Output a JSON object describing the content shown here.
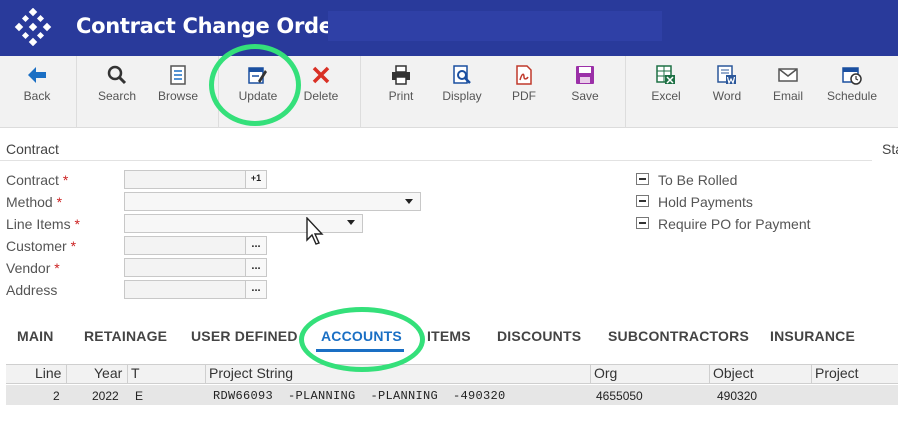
{
  "window": {
    "title": "Contract Change Orders"
  },
  "toolbar": {
    "buttons": [
      {
        "label": "Back",
        "icon": "back-arrow-icon"
      },
      {
        "label": "Search",
        "icon": "search-icon"
      },
      {
        "label": "Browse",
        "icon": "browse-icon"
      },
      {
        "label": "Update",
        "icon": "edit-icon"
      },
      {
        "label": "Delete",
        "icon": "delete-icon"
      },
      {
        "label": "Print",
        "icon": "printer-icon"
      },
      {
        "label": "Display",
        "icon": "display-icon"
      },
      {
        "label": "PDF",
        "icon": "pdf-icon"
      },
      {
        "label": "Save",
        "icon": "save-icon"
      },
      {
        "label": "Excel",
        "icon": "excel-icon"
      },
      {
        "label": "Word",
        "icon": "word-icon"
      },
      {
        "label": "Email",
        "icon": "email-icon"
      },
      {
        "label": "Schedule",
        "icon": "schedule-icon"
      }
    ]
  },
  "form": {
    "section_title": "Contract",
    "side_section_title": "Sta",
    "fields": [
      {
        "label": "Contract",
        "required": true,
        "value": "",
        "button": "+1"
      },
      {
        "label": "Method",
        "required": true,
        "value": "",
        "type": "dropdown"
      },
      {
        "label": "Line Items",
        "required": true,
        "value": "",
        "type": "dropdown"
      },
      {
        "label": "Customer",
        "required": true,
        "value": "",
        "button": "..."
      },
      {
        "label": "Vendor",
        "required": true,
        "value": "",
        "button": "..."
      },
      {
        "label": "Address",
        "required": false,
        "value": "",
        "button": "..."
      }
    ],
    "required_marker": "*",
    "checkboxes": [
      {
        "label": "To Be Rolled"
      },
      {
        "label": "Hold Payments"
      },
      {
        "label": "Require PO for Payment"
      }
    ]
  },
  "tabs": [
    {
      "label": "MAIN"
    },
    {
      "label": "RETAINAGE"
    },
    {
      "label": "USER DEFINED"
    },
    {
      "label": "ACCOUNTS",
      "active": true
    },
    {
      "label": "ITEMS"
    },
    {
      "label": "DISCOUNTS"
    },
    {
      "label": "SUBCONTRACTORS"
    },
    {
      "label": "INSURANCE"
    }
  ],
  "table": {
    "columns": [
      "Line",
      "Year",
      "T",
      "Project String",
      "Org",
      "Object",
      "Project"
    ],
    "rows": [
      {
        "line": "2",
        "year": "2022",
        "t": "E",
        "project_string": "RDW66093  -PLANNING  -PLANNING  -490320",
        "org": "4655050",
        "object": "490320",
        "project": ""
      }
    ]
  },
  "colors": {
    "title_bar": "#293a9b",
    "accent": "#1a6fc4",
    "annotation": "#34e07a",
    "required": "#cc2222"
  }
}
